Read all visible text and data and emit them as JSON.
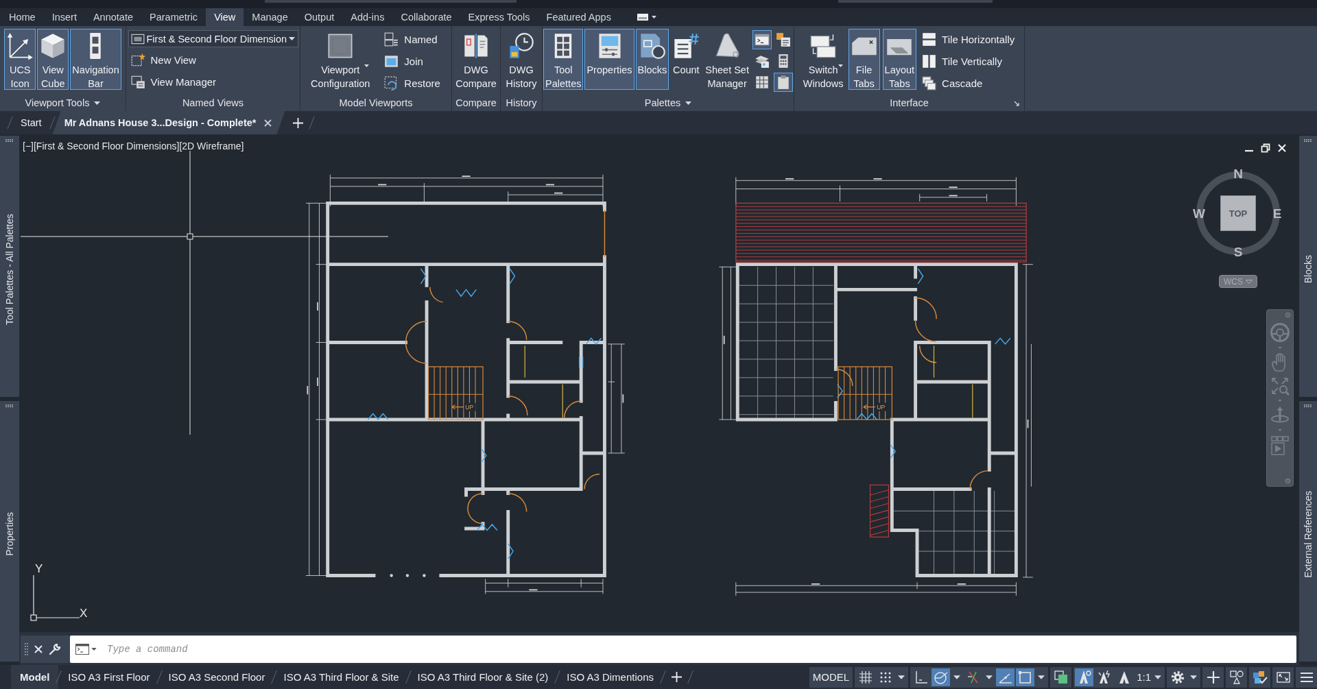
{
  "ribbon_tabs": [
    {
      "label": "Home",
      "selected": false
    },
    {
      "label": "Insert",
      "selected": false
    },
    {
      "label": "Annotate",
      "selected": false
    },
    {
      "label": "Parametric",
      "selected": false
    },
    {
      "label": "View",
      "selected": true
    },
    {
      "label": "Manage",
      "selected": false
    },
    {
      "label": "Output",
      "selected": false
    },
    {
      "label": "Add-ins",
      "selected": false
    },
    {
      "label": "Collaborate",
      "selected": false
    },
    {
      "label": "Express Tools",
      "selected": false
    },
    {
      "label": "Featured Apps",
      "selected": false
    }
  ],
  "ribbon_panels": [
    {
      "title": "Viewport Tools",
      "menu": true,
      "items": [
        {
          "kind": "large",
          "label": "UCS\nIcon",
          "on": true
        },
        {
          "kind": "large",
          "label": "View\nCube",
          "on": true
        },
        {
          "kind": "large",
          "label": "Navigation\nBar",
          "on": true
        }
      ]
    },
    {
      "title": "Named Views",
      "items": [
        {
          "kind": "dropdown",
          "value": "First & Second Floor Dimension"
        },
        {
          "kind": "small",
          "label": "New View"
        },
        {
          "kind": "small",
          "label": "View Manager"
        }
      ]
    },
    {
      "title": "Model Viewports",
      "items": [
        {
          "kind": "large",
          "label": "Viewport\nConfiguration",
          "on": false,
          "menu": true
        },
        {
          "kind": "small",
          "label": "Named"
        },
        {
          "kind": "small",
          "label": "Join"
        },
        {
          "kind": "small",
          "label": "Restore"
        }
      ]
    },
    {
      "title": "Compare",
      "items": [
        {
          "kind": "large",
          "label": "DWG\nCompare",
          "on": false
        }
      ]
    },
    {
      "title": "History",
      "items": [
        {
          "kind": "large",
          "label": "DWG\nHistory",
          "on": false
        }
      ]
    },
    {
      "title": "Palettes",
      "menu": true,
      "items": [
        {
          "kind": "large",
          "label": "Tool\nPalettes",
          "on": true
        },
        {
          "kind": "large",
          "label": "Properties",
          "on": true
        },
        {
          "kind": "large",
          "label": "Blocks",
          "on": true
        },
        {
          "kind": "large",
          "label": "Count",
          "on": false
        },
        {
          "kind": "large",
          "label": "Sheet Set\nManager",
          "on": false
        },
        {
          "kind": "icon",
          "on": true
        },
        {
          "kind": "icon",
          "on": false
        },
        {
          "kind": "icon",
          "on": false
        },
        {
          "kind": "icon",
          "on": false
        },
        {
          "kind": "icon",
          "on": false
        },
        {
          "kind": "icon",
          "on": true
        }
      ]
    },
    {
      "title": "Interface",
      "launcher": true,
      "items": [
        {
          "kind": "large",
          "label": "Switch\nWindows",
          "on": false,
          "menu": true
        },
        {
          "kind": "large",
          "label": "File\nTabs",
          "on": true
        },
        {
          "kind": "large",
          "label": "Layout\nTabs",
          "on": true
        },
        {
          "kind": "small",
          "label": "Tile Horizontally"
        },
        {
          "kind": "small",
          "label": "Tile Vertically"
        },
        {
          "kind": "small",
          "label": "Cascade"
        }
      ]
    }
  ],
  "file_tabs": [
    {
      "label": "Start",
      "selected": false
    },
    {
      "label": "Mr Adnans House 3...Design - Complete*",
      "selected": true
    }
  ],
  "left_palettes": [
    "Tool Palettes - All Palettes",
    "Properties"
  ],
  "right_palettes": [
    "Blocks",
    "External References"
  ],
  "viewport": {
    "controls": [
      "[−]",
      "[First & Second Floor Dimensions]",
      "[2D Wireframe]"
    ],
    "view_cube": {
      "north": "N",
      "east": "E",
      "south": "S",
      "west": "W",
      "face": "TOP",
      "coordinate_system": "WCS"
    },
    "ucs_icon": {
      "x_label": "X",
      "y_label": "Y"
    },
    "drawings": [
      {
        "stair_label": "UP"
      },
      {
        "stair_label": "UP"
      }
    ]
  },
  "command_line": {
    "placeholder": "Type a command"
  },
  "layout_tabs": [
    {
      "label": "Model",
      "selected": true
    },
    {
      "label": "ISO A3 First Floor",
      "selected": false
    },
    {
      "label": "ISO A3 Second Floor",
      "selected": false
    },
    {
      "label": "ISO A3 Third Floor & Site",
      "selected": false
    },
    {
      "label": "ISO A3 Third Floor & Site (2)",
      "selected": false
    },
    {
      "label": "ISO A3 Dimentions",
      "selected": false
    }
  ],
  "status_bar": {
    "space": "MODEL",
    "toggles": [
      {
        "on": false
      },
      {
        "on": false,
        "menu": true
      },
      {
        "on": false
      },
      {
        "on": true,
        "menu": true
      },
      {
        "on": false,
        "menu": true
      },
      {
        "on": true
      },
      {
        "on": true,
        "menu": true
      },
      {
        "on": false
      },
      {
        "on": true
      },
      {
        "on": false
      },
      {
        "on": false
      }
    ],
    "annotation_scale": "1:1"
  }
}
